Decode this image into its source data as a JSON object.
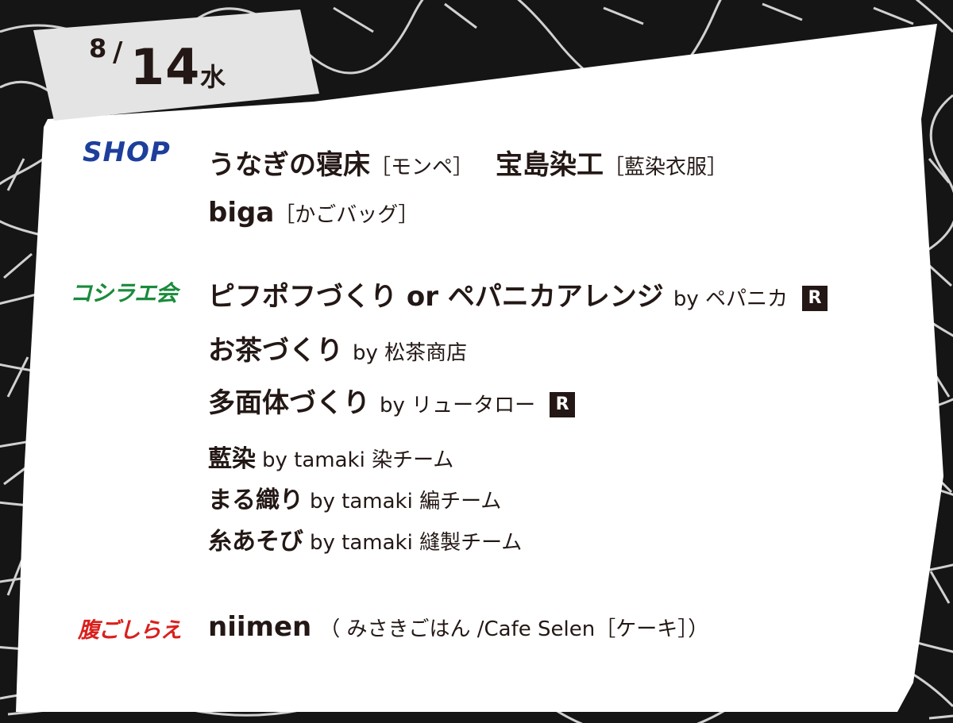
{
  "date": {
    "month": "8",
    "slash": "/",
    "day": "14",
    "weekday": "水"
  },
  "categories": {
    "shop": "SHOP",
    "koshirae": "コシラエ会",
    "hara": "腹ごしらえ"
  },
  "shop": {
    "line1": [
      {
        "name": "うなぎの寝床",
        "note": "［モンペ］"
      },
      {
        "name": "宝島染工",
        "note": "［藍染衣服］"
      }
    ],
    "line2": [
      {
        "name": "biga",
        "note": "［かごバッグ］"
      }
    ]
  },
  "koshirae": {
    "items": [
      {
        "title": "ピフポフづくり or ペパニカアレンジ",
        "by": "by ペパニカ",
        "badge": "R"
      },
      {
        "title": "お茶づくり",
        "by": "by 松茶商店"
      },
      {
        "title": "多面体づくり",
        "by": "by リュータロー",
        "badge": "R"
      }
    ],
    "tamaki": [
      {
        "title": "藍染",
        "by": "by tamaki 染チーム"
      },
      {
        "title": "まる織り",
        "by": "by tamaki 編チーム"
      },
      {
        "title": "糸あそび",
        "by": "by tamaki 縫製チーム"
      }
    ]
  },
  "food": {
    "name": "niimen",
    "note": "（ みさきごはん /Cafe Selen［ケーキ］）"
  }
}
